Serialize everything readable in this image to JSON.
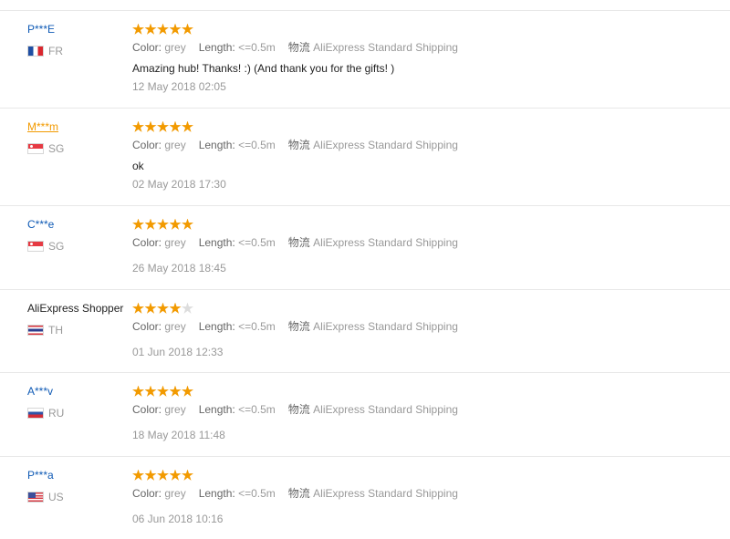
{
  "colors": {
    "link_blue": "#0f5ab5",
    "hover_orange": "#f29a00",
    "star_orange": "#f29a00",
    "star_empty": "#dddddd",
    "meta_gray": "#999999",
    "text_dark": "#222222"
  },
  "labels": {
    "color": "Color:",
    "length": "Length:",
    "shipping": "物流"
  },
  "reviews": [
    {
      "user": "P***E",
      "country": "FR",
      "flag": "france-flag",
      "rating": 5,
      "color": "grey",
      "length": "<=0.5m",
      "shipping": "AliExpress Standard Shipping",
      "text": "Amazing hub! Thanks! :) (And thank you for the gifts! )",
      "date": "12 May 2018 02:05"
    },
    {
      "user": "M***m",
      "country": "SG",
      "flag": "singapore-flag",
      "rating": 5,
      "color": "grey",
      "length": "<=0.5m",
      "shipping": "AliExpress Standard Shipping",
      "text": "ok",
      "date": "02 May 2018 17:30"
    },
    {
      "user": "C***e",
      "country": "SG",
      "flag": "singapore-flag",
      "rating": 5,
      "color": "grey",
      "length": "<=0.5m",
      "shipping": "AliExpress Standard Shipping",
      "text": "",
      "date": "26 May 2018 18:45"
    },
    {
      "user": "AliExpress Shopper",
      "country": "TH",
      "flag": "thailand-flag",
      "rating": 4,
      "color": "grey",
      "length": "<=0.5m",
      "shipping": "AliExpress Standard Shipping",
      "text": "",
      "date": "01 Jun 2018 12:33"
    },
    {
      "user": "A***v",
      "country": "RU",
      "flag": "russia-flag",
      "rating": 5,
      "color": "grey",
      "length": "<=0.5m",
      "shipping": "AliExpress Standard Shipping",
      "text": "",
      "date": "18 May 2018 11:48"
    },
    {
      "user": "P***a",
      "country": "US",
      "flag": "usa-flag",
      "rating": 5,
      "color": "grey",
      "length": "<=0.5m",
      "shipping": "AliExpress Standard Shipping",
      "text": "",
      "date": "06 Jun 2018 10:16"
    }
  ]
}
